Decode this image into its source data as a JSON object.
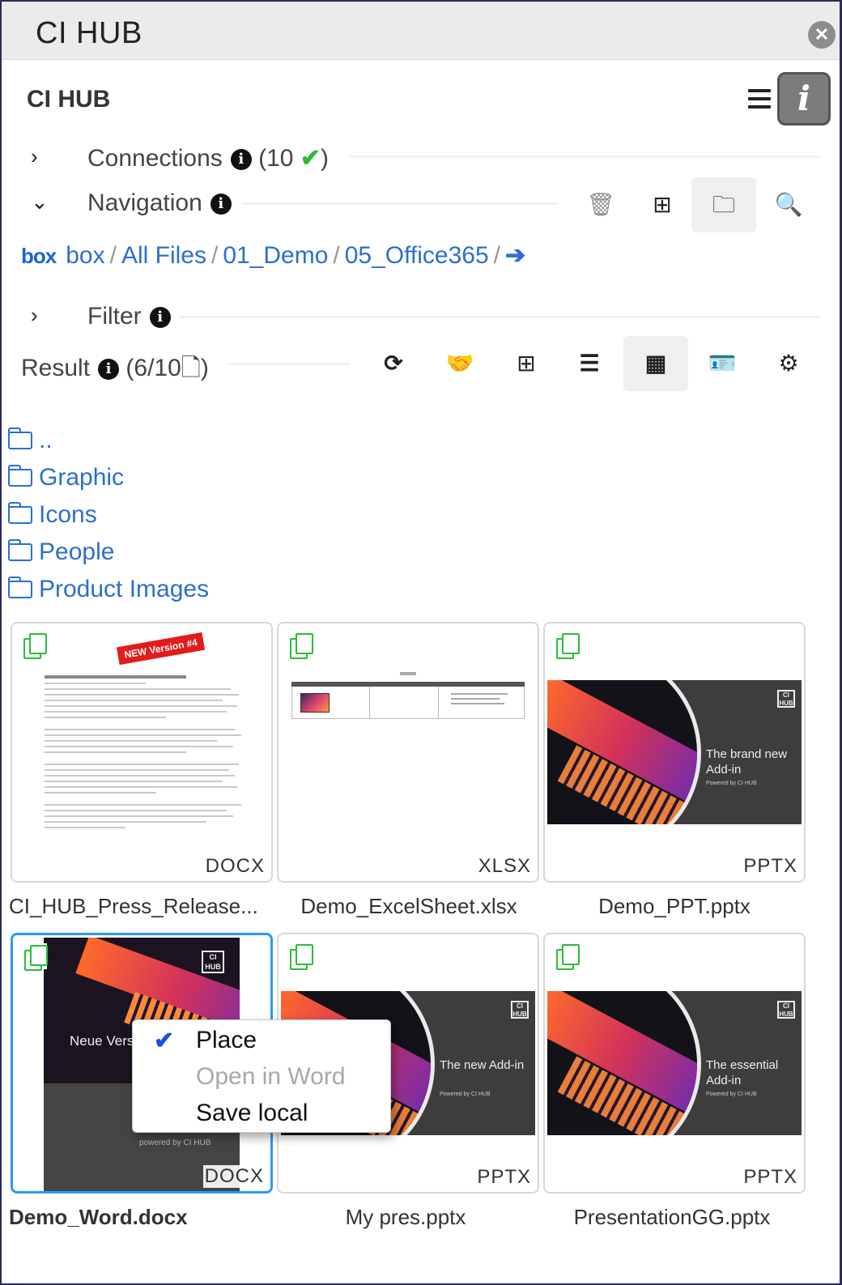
{
  "window": {
    "title": "CI HUB"
  },
  "header": {
    "app_name": "CI HUB"
  },
  "connections": {
    "label": "Connections",
    "count_open": "(10",
    "count_close": ")",
    "check": "✔"
  },
  "navigation": {
    "label": "Navigation"
  },
  "breadcrumb": {
    "logo": "box",
    "items": [
      "box",
      "All Files",
      "01_Demo",
      "05_Office365"
    ],
    "separator": "/"
  },
  "filter": {
    "label": "Filter"
  },
  "result": {
    "label": "Result",
    "count_open": "(6/10",
    "count_close": ")"
  },
  "folders": [
    "..",
    "Graphic",
    "Icons",
    "People",
    "Product Images"
  ],
  "assets": [
    {
      "name": "CI_HUB_Press_Release...",
      "type": "DOCX",
      "kind": "doc",
      "ribbon": "NEW Version #4"
    },
    {
      "name": "Demo_ExcelSheet.xlsx",
      "type": "XLSX",
      "kind": "xlsx"
    },
    {
      "name": "Demo_PPT.pptx",
      "type": "PPTX",
      "kind": "slide",
      "slide_title": "The brand new Add-in",
      "slide_sub": "Powered by CI HUB",
      "logo": "CI HUB"
    },
    {
      "name": "Demo_Word.docx",
      "type": "DOCX",
      "kind": "word",
      "selected": true,
      "thumb_title": "Neue Vers aus box",
      "thumb_sub": "powered by CI HUB",
      "logo": "CI HUB"
    },
    {
      "name": "My pres.pptx",
      "type": "PPTX",
      "kind": "slide",
      "slide_title": "The new Add-in",
      "slide_sub": "Powered by CI HUB",
      "logo": "CI HUB"
    },
    {
      "name": "PresentationGG.pptx",
      "type": "PPTX",
      "kind": "slide",
      "slide_title": "The essential Add-in",
      "slide_sub": "Powered by CI HUB",
      "logo": "CI HUB"
    }
  ],
  "context_menu": {
    "items": [
      {
        "label": "Place",
        "checked": true,
        "enabled": true
      },
      {
        "label": "Open in Word",
        "checked": false,
        "enabled": false
      },
      {
        "label": "Save local",
        "checked": false,
        "enabled": true
      }
    ]
  },
  "colors": {
    "accent": "#2c6fcf",
    "success": "#2dbb3a",
    "selection": "#2b9af3"
  }
}
